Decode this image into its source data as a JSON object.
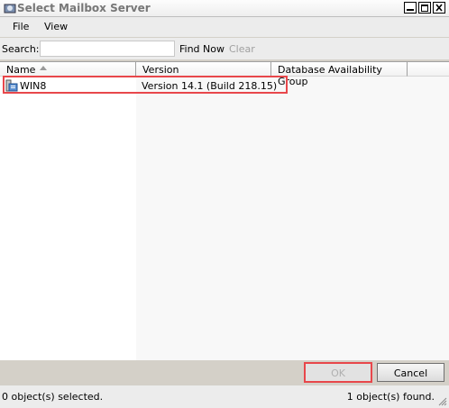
{
  "window": {
    "title": "Select Mailbox Server"
  },
  "menu": {
    "items": [
      {
        "label": "File"
      },
      {
        "label": "View"
      }
    ]
  },
  "search": {
    "label": "Search:",
    "value": "",
    "find_now": "Find Now",
    "clear": "Clear"
  },
  "columns": [
    {
      "label": "Name"
    },
    {
      "label": "Version"
    },
    {
      "label": "Database Availability Group"
    }
  ],
  "rows": [
    {
      "name": "WIN8",
      "version": "Version 14.1 (Build 218.15)",
      "dag": ""
    }
  ],
  "buttons": {
    "ok": "OK",
    "cancel": "Cancel"
  },
  "status": {
    "selected": "0 object(s) selected.",
    "found": "1 object(s) found."
  },
  "colors": {
    "highlight": "#e8474b",
    "disabled_text": "#b0b0b0"
  }
}
